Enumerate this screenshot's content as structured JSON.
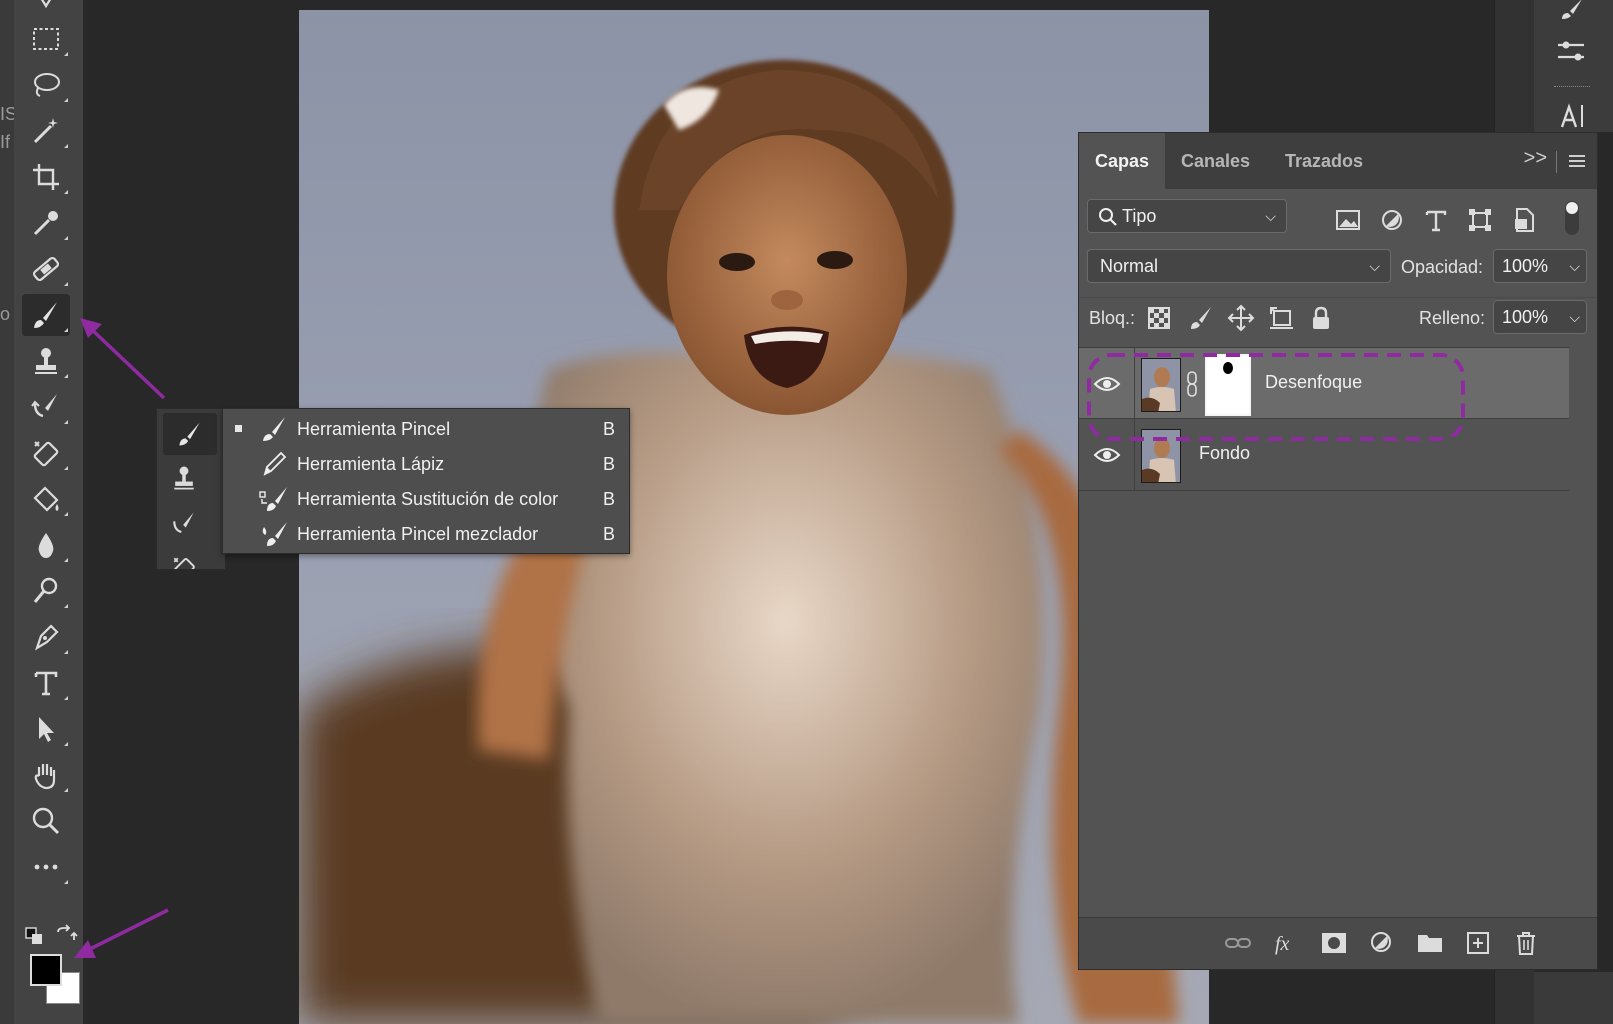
{
  "left_edge": {
    "fragments": [
      "IS",
      "If",
      "o"
    ]
  },
  "toolbar": {
    "tools": [
      "marquee-tool",
      "lasso-tool",
      "magic-wand-tool",
      "crop-tool",
      "eyedropper-tool",
      "healing-tool",
      "brush-tool",
      "stamp-tool",
      "history-brush-tool",
      "eraser-tool",
      "paint-bucket-tool",
      "blur-tool",
      "dodge-tool",
      "pen-tool",
      "type-tool",
      "path-selection-tool",
      "hand-tool",
      "zoom-tool",
      "more-tools"
    ],
    "active_tool": "brush-tool",
    "foreground_color": "#000000",
    "background_color": "#ffffff"
  },
  "brush_flyout": {
    "items": [
      {
        "label": "Herramienta Pincel",
        "shortcut": "B",
        "selected": true,
        "icon": "brush-icon"
      },
      {
        "label": "Herramienta Lápiz",
        "shortcut": "B",
        "selected": false,
        "icon": "pencil-icon"
      },
      {
        "label": "Herramienta Sustitución de color",
        "shortcut": "B",
        "selected": false,
        "icon": "color-replacement-icon"
      },
      {
        "label": "Herramienta Pincel mezclador",
        "shortcut": "B",
        "selected": false,
        "icon": "mixer-brush-icon"
      }
    ]
  },
  "layers_panel": {
    "tabs": [
      {
        "label": "Capas",
        "active": true
      },
      {
        "label": "Canales",
        "active": false
      },
      {
        "label": "Trazados",
        "active": false
      }
    ],
    "collapse_label": ">>",
    "filter": {
      "value": "Tipo"
    },
    "blend": {
      "value": "Normal"
    },
    "opacity": {
      "label": "Opacidad:",
      "value": "100%"
    },
    "lock": {
      "label": "Bloq.:"
    },
    "fill": {
      "label": "Relleno:",
      "value": "100%"
    },
    "layers": [
      {
        "name": "Desenfoque",
        "visible": true,
        "selected": true,
        "has_mask": true
      },
      {
        "name": "Fondo",
        "visible": true,
        "selected": false,
        "has_mask": false
      }
    ]
  },
  "colors": {
    "highlight": "#8f2aa0",
    "panel_bg": "#535353",
    "toolbar_bg": "#434343"
  }
}
